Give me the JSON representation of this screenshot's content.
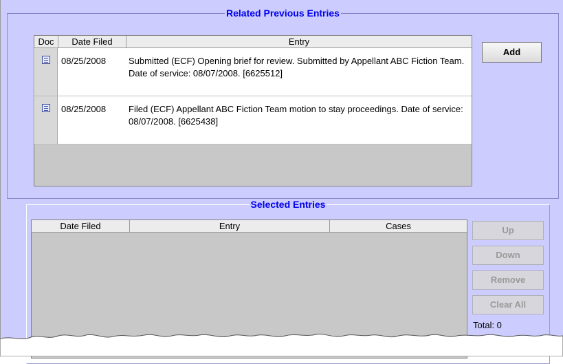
{
  "related": {
    "title": "Related Previous Entries",
    "columns": [
      "Doc",
      "Date Filed",
      "Entry"
    ],
    "rows": [
      {
        "date": "08/25/2008",
        "entry": "Submitted (ECF) Opening brief for review. Submitted by Appellant ABC Fiction Team. Date of service: 08/07/2008. [6625512]",
        "icon": "document-icon"
      },
      {
        "date": "08/25/2008",
        "entry": "Filed (ECF) Appellant ABC Fiction Team motion to stay proceedings. Date of service: 08/07/2008. [6625438]",
        "icon": "document-icon"
      }
    ],
    "add_label": "Add"
  },
  "selected": {
    "title": "Selected Entries",
    "columns": [
      "Date Filed",
      "Entry",
      "Cases"
    ],
    "buttons": {
      "up": "Up",
      "down": "Down",
      "remove": "Remove",
      "clear_all": "Clear All"
    },
    "total_label": "Total: 0"
  },
  "colors": {
    "panel_bg": "#ccccff",
    "title_blue": "#0000ee",
    "table_empty": "#c8c8c8"
  }
}
